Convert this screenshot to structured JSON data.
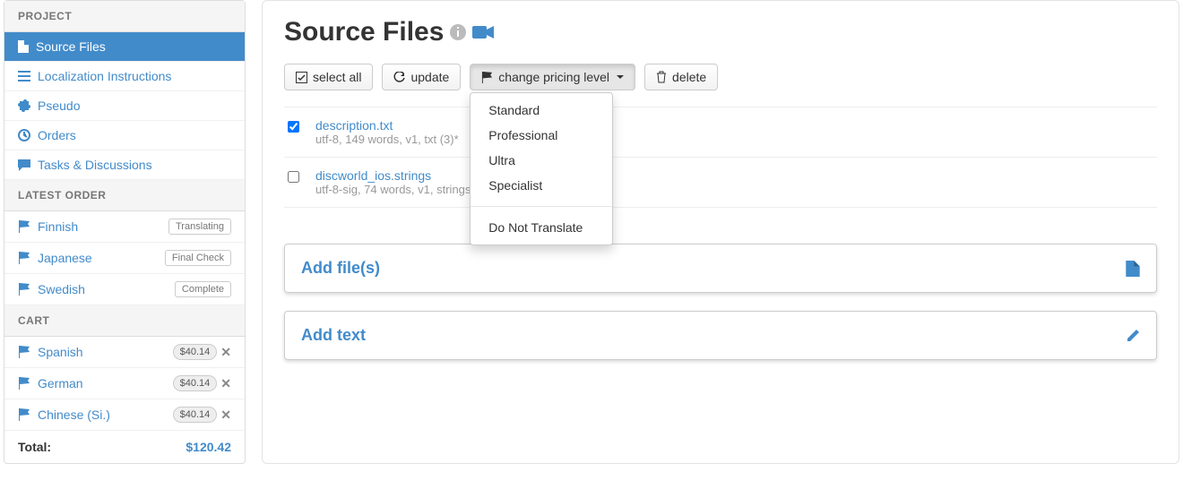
{
  "sidebar": {
    "sections": {
      "project": {
        "header": "PROJECT",
        "items": [
          {
            "label": "Source Files",
            "icon": "file-icon",
            "active": true
          },
          {
            "label": "Localization Instructions",
            "icon": "list-icon",
            "active": false
          },
          {
            "label": "Pseudo",
            "icon": "puzzle-icon",
            "active": false
          },
          {
            "label": "Orders",
            "icon": "clock-icon",
            "active": false
          },
          {
            "label": "Tasks & Discussions",
            "icon": "comment-icon",
            "active": false
          }
        ]
      },
      "latest_order": {
        "header": "LATEST ORDER",
        "items": [
          {
            "label": "Finnish",
            "status": "Translating"
          },
          {
            "label": "Japanese",
            "status": "Final Check"
          },
          {
            "label": "Swedish",
            "status": "Complete"
          }
        ]
      },
      "cart": {
        "header": "CART",
        "items": [
          {
            "label": "Spanish",
            "price": "$40.14"
          },
          {
            "label": "German",
            "price": "$40.14"
          },
          {
            "label": "Chinese (Si.)",
            "price": "$40.14"
          }
        ],
        "total_label": "Total:",
        "total_amount": "$120.42"
      }
    }
  },
  "main": {
    "title": "Source Files",
    "toolbar": {
      "select_all": "select all",
      "update": "update",
      "change_pricing": "change pricing level",
      "delete": "delete"
    },
    "pricing_levels": [
      "Standard",
      "Professional",
      "Ultra",
      "Specialist",
      "Do Not Translate"
    ],
    "files": [
      {
        "checked": true,
        "name": "description.txt",
        "meta": "utf-8, 149 words, v1, txt (3)*"
      },
      {
        "checked": false,
        "name": "discworld_ios.strings",
        "meta": "utf-8-sig, 74 words, v1, strings"
      }
    ],
    "add_files_label": "Add file(s)",
    "add_text_label": "Add text"
  }
}
